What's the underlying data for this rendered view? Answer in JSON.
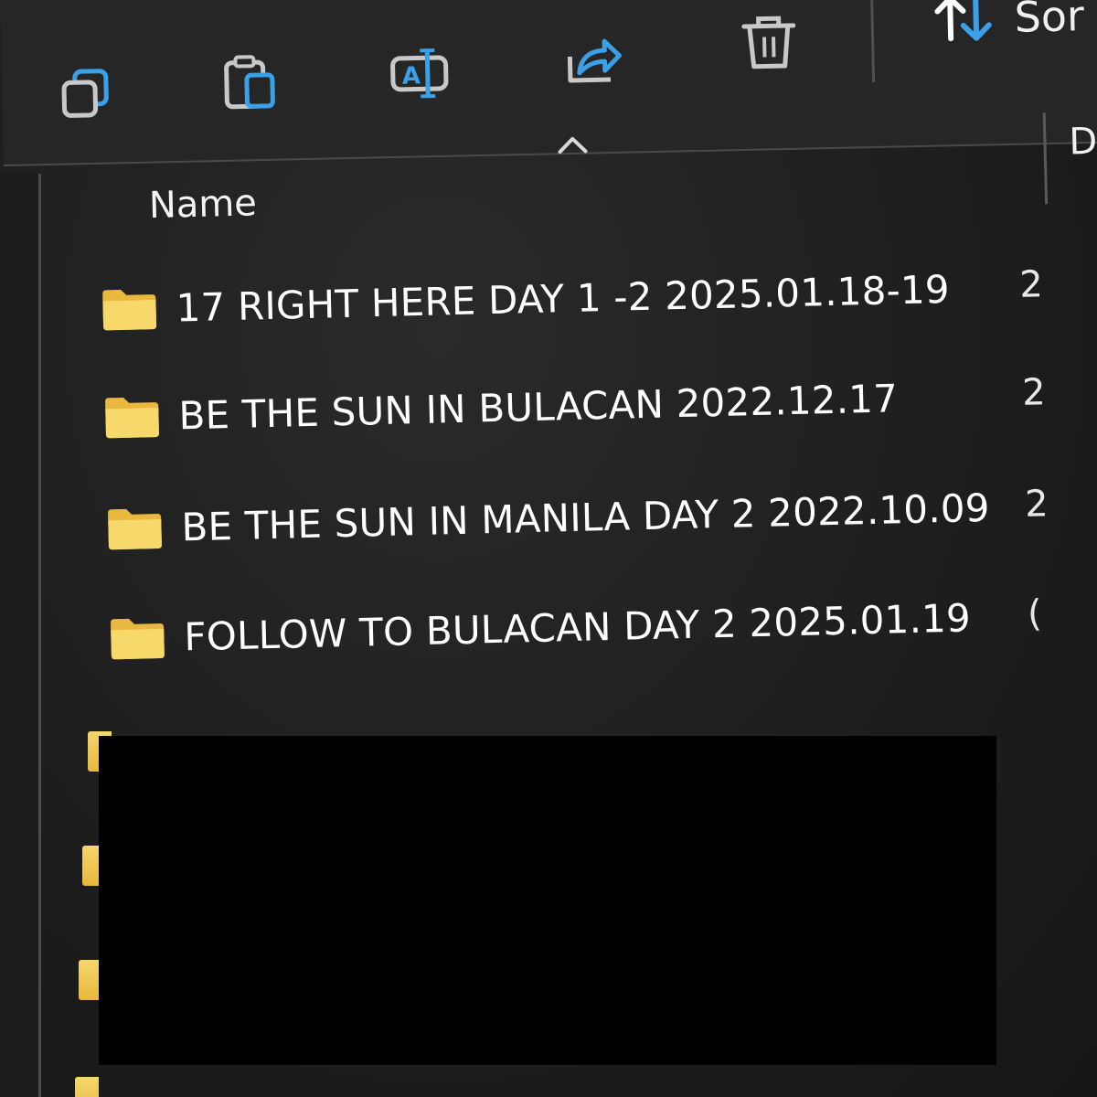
{
  "toolbar": {
    "icons": [
      "copy-icon",
      "paste-icon",
      "rename-icon",
      "share-icon",
      "delete-icon"
    ],
    "sort_label": "Sor"
  },
  "columns": {
    "name": "Name",
    "date_partial": "D"
  },
  "rows": [
    {
      "name": "17 RIGHT HERE DAY 1 -2 2025.01.18-19",
      "date_partial": "2"
    },
    {
      "name": "BE THE SUN IN BULACAN 2022.12.17",
      "date_partial": "2"
    },
    {
      "name": "BE THE SUN IN MANILA DAY 2 2022.10.09",
      "date_partial": "2"
    },
    {
      "name": "FOLLOW TO BULACAN DAY 2 2025.01.19",
      "date_partial": "("
    }
  ],
  "colors": {
    "background": "#1f1f1f",
    "folder_yellow": "#f2cf5b",
    "accent_blue": "#3aa0e8"
  }
}
